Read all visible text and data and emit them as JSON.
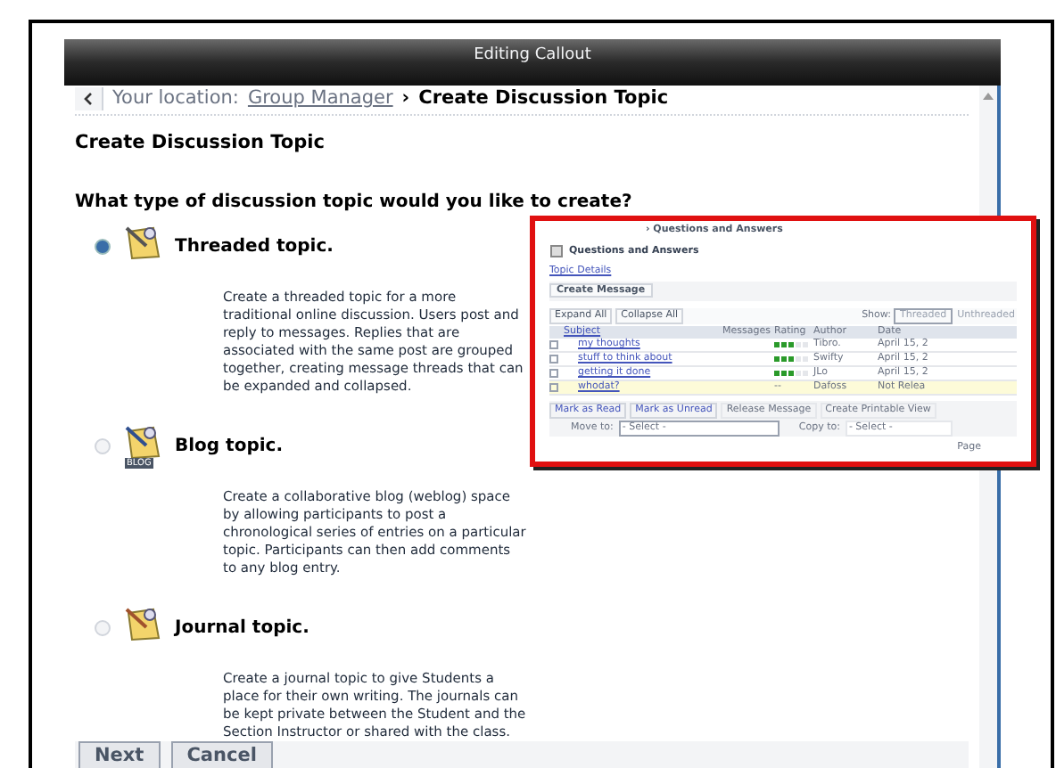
{
  "window": {
    "title": "Editing Callout"
  },
  "breadcrumb": {
    "label": "Your location:",
    "link": "Group Manager",
    "separator": "›",
    "current": "Create Discussion Topic"
  },
  "heading": "Create Discussion Topic",
  "question": "What type of discussion topic would you like to create?",
  "options": [
    {
      "kind": "threaded",
      "title": "Threaded topic.",
      "description": "Create a threaded topic for a more traditional online discussion. Users post and reply to messages. Replies that are associated with the same post are grouped together, creating message threads that can be expanded and collapsed.",
      "selected": true
    },
    {
      "kind": "blog",
      "title": "Blog topic.",
      "badge": "BLOG",
      "description": "Create a collaborative blog (weblog) space by allowing participants to post a chronological series of entries on a particular topic. Participants can then add comments to any blog entry.",
      "selected": false
    },
    {
      "kind": "journal",
      "title": "Journal topic.",
      "description": "Create a journal topic to give Students a place for their own writing. The journals can be kept private between the Student and the Section Instructor or shared with the class.",
      "selected": false
    }
  ],
  "callout": {
    "crumb": "› Questions and Answers",
    "title": "Questions and Answers",
    "link": "Topic Details",
    "create_button": "Create Message",
    "toolbar": [
      "Expand All",
      "Collapse All"
    ],
    "show_label": "Show:",
    "views": [
      {
        "label": "Threaded",
        "selected": true
      },
      {
        "label": "Unthreaded",
        "selected": false
      }
    ],
    "columns": [
      "Subject",
      "Messages",
      "Rating",
      "Author",
      "Date"
    ],
    "rows": [
      {
        "subject": "my thoughts",
        "stars": 3,
        "author": "Tibro.",
        "date": "April 15, 2",
        "highlighted": false
      },
      {
        "subject": "stuff to think about",
        "stars": 3,
        "author": "Swifty",
        "date": "April 15, 2",
        "highlighted": false
      },
      {
        "subject": "getting it done",
        "stars": 3,
        "author": "JLo",
        "date": "April 15, 2",
        "highlighted": false
      },
      {
        "subject": "whodat?",
        "rating": "--",
        "author": "Dafoss",
        "date": "Not Relea",
        "highlighted": true
      }
    ],
    "actions": [
      "Mark as Read",
      "Mark as Unread",
      "Release Message",
      "Create Printable View"
    ],
    "move_label": "Move to:",
    "move_value": "- Select -",
    "copy_label": "Copy to:",
    "copy_value": "- Select -",
    "page_label": "Page"
  },
  "buttons": [
    "Next",
    "Cancel"
  ]
}
